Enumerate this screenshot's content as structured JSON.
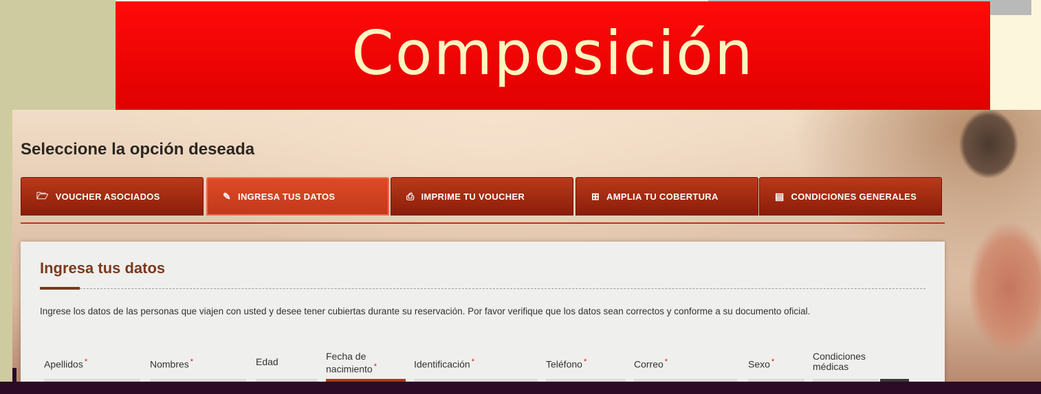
{
  "slide": {
    "title": "Composición"
  },
  "screen": {
    "heading": "Seleccione la opción deseada",
    "tabs": [
      {
        "label": "VOUCHER ASOCIADOS",
        "icon": "folder-open-icon"
      },
      {
        "label": "INGRESA TUS DATOS",
        "icon": "edit-icon"
      },
      {
        "label": "IMPRIME TU VOUCHER",
        "icon": "print-icon"
      },
      {
        "label": "AMPLIA TU COBERTURA",
        "icon": "plus-square-icon"
      },
      {
        "label": "CONDICIONES GENERALES",
        "icon": "document-icon"
      }
    ],
    "panel": {
      "title": "Ingresa tus datos",
      "intro": "Ingrese los datos de las personas que viajen con usted y desee tener cubiertas durante su reservación. Por favor verifique que los datos sean correctos y conforme a su documento oficial.",
      "columns": [
        {
          "label": "Apellidos",
          "required": "*"
        },
        {
          "label": "Nombres",
          "required": "*"
        },
        {
          "label": "Edad",
          "required": ""
        },
        {
          "label": "Fecha de",
          "label2": "nacimiento",
          "required": "*"
        },
        {
          "label": "Identificación",
          "required": "*"
        },
        {
          "label": "Teléfono",
          "required": "*"
        },
        {
          "label": "Correo",
          "required": "*"
        },
        {
          "label": "Sexo",
          "required": "*"
        },
        {
          "label": "Condiciones",
          "label2": "médicas",
          "required": ""
        }
      ]
    }
  },
  "colors": {
    "banner": "#ff0000",
    "tab": "#a8290f",
    "accent": "#7a3a1b",
    "background": "#fbf6dc"
  }
}
